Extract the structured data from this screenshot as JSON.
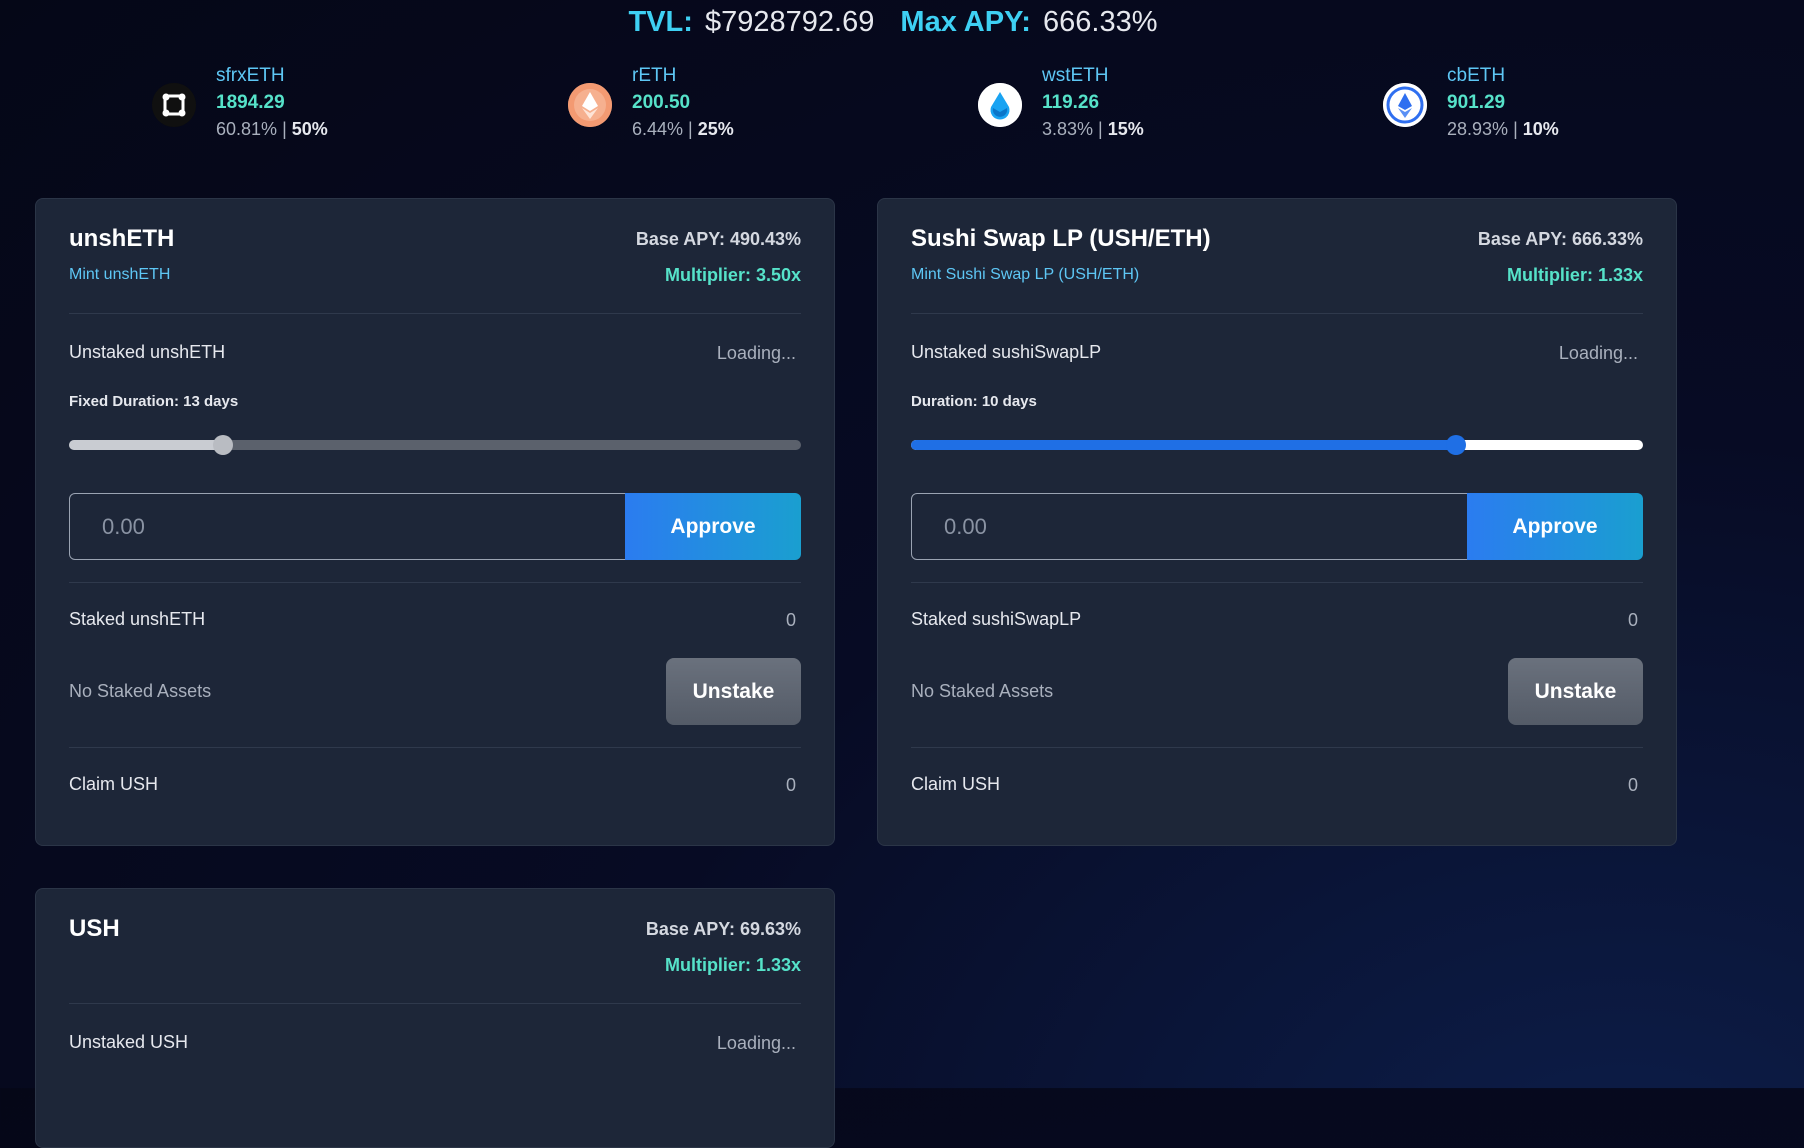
{
  "header": {
    "tvl_label": "TVL:",
    "tvl_value": "$7928792.69",
    "max_apy_label": "Max APY:",
    "max_apy_value": "666.33%"
  },
  "tokens": [
    {
      "name": "sfrxETH",
      "price": "1894.29",
      "apy": "60.81%",
      "sep": " | ",
      "weight": "50%",
      "icon": "sfrxeth-icon"
    },
    {
      "name": "rETH",
      "price": "200.50",
      "apy": "6.44%",
      "sep": " | ",
      "weight": "25%",
      "icon": "reth-icon"
    },
    {
      "name": "wstETH",
      "price": "119.26",
      "apy": "3.83%",
      "sep": " | ",
      "weight": "15%",
      "icon": "wsteth-icon"
    },
    {
      "name": "cbETH",
      "price": "901.29",
      "apy": "28.93%",
      "sep": " | ",
      "weight": "10%",
      "icon": "cbeth-icon"
    }
  ],
  "cards": [
    {
      "title": "unshETH",
      "link": "Mint unshETH",
      "base_apy": "Base APY: 490.43%",
      "multiplier": "Multiplier: 3.50x",
      "unstaked_label": "Unstaked unshETH",
      "unstaked_value": "Loading...",
      "duration_label": "Fixed Duration: 13 days",
      "duration_fraction": 0.21,
      "amount_placeholder": "0.00",
      "approve_label": "Approve",
      "staked_label": "Staked unshETH",
      "staked_value": "0",
      "no_staked": "No Staked Assets",
      "unstake_label": "Unstake",
      "claim_label": "Claim USH",
      "claim_value": "0"
    },
    {
      "title": "Sushi Swap LP (USH/ETH)",
      "link": "Mint Sushi Swap LP (USH/ETH)",
      "base_apy": "Base APY: 666.33%",
      "multiplier": "Multiplier: 1.33x",
      "unstaked_label": "Unstaked sushiSwapLP",
      "unstaked_value": "Loading...",
      "duration_label": "Duration: 10 days",
      "duration_fraction": 0.745,
      "amount_placeholder": "0.00",
      "approve_label": "Approve",
      "staked_label": "Staked sushiSwapLP",
      "staked_value": "0",
      "no_staked": "No Staked Assets",
      "unstake_label": "Unstake",
      "claim_label": "Claim USH",
      "claim_value": "0"
    },
    {
      "title": "USH",
      "base_apy": "Base APY: 69.63%",
      "multiplier": "Multiplier: 1.33x",
      "unstaked_label": "Unstaked USH",
      "unstaked_value": "Loading..."
    }
  ],
  "colors": {
    "accent_cyan": "#3ed0f3",
    "accent_green": "#56e2c9",
    "slider_blue": "#1f6fe5",
    "card_bg": "#1d2638"
  }
}
